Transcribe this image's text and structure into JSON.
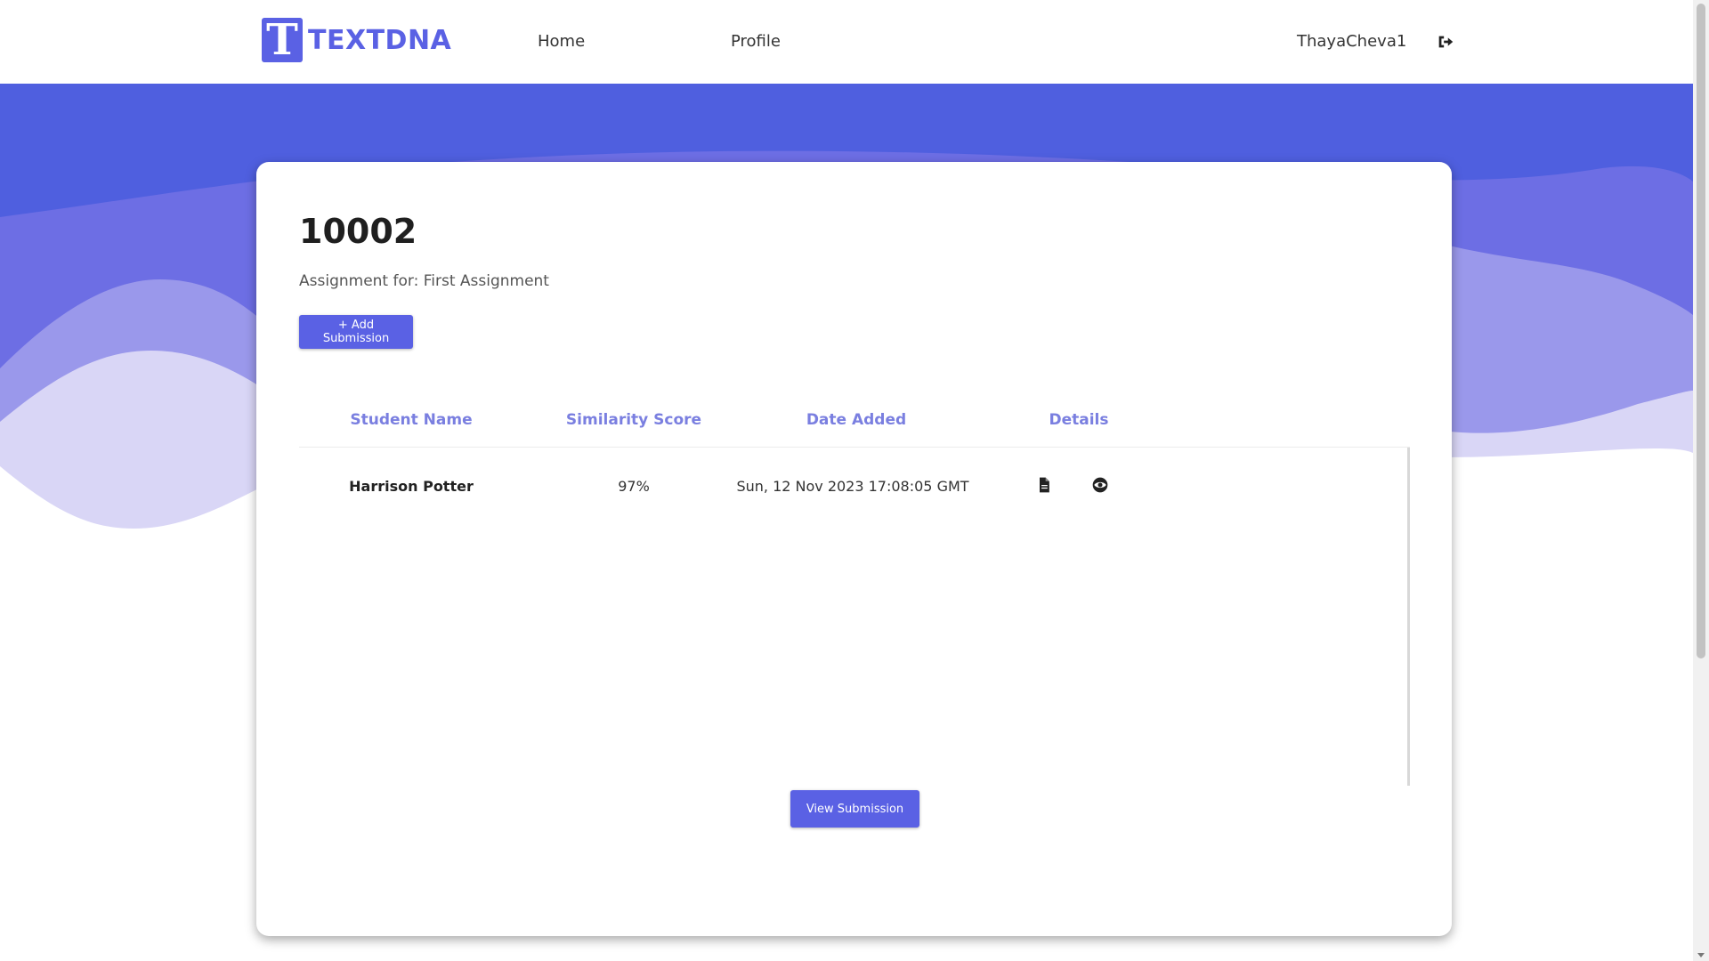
{
  "brand": {
    "logo_letter": "T",
    "name": "TEXTDNA",
    "color": "#5a61e4"
  },
  "nav": {
    "home_label": "Home",
    "profile_label": "Profile",
    "username": "ThayaCheva1"
  },
  "assignment": {
    "id": "10002",
    "subtitle": "Assignment for: First Assignment",
    "add_button_label": "+ Add Submission"
  },
  "table": {
    "headers": [
      "Student Name",
      "Similarity Score",
      "Date Added",
      "Details"
    ],
    "rows": [
      {
        "student_name": "Harrison Potter",
        "similarity_score": "97%",
        "date_added": "Sun, 12 Nov 2023 17:08:05 GMT",
        "detail_icons": [
          "document-icon",
          "eye-icon"
        ]
      }
    ]
  },
  "view_button_label": "View Submission",
  "colors": {
    "accent": "#5a61e4",
    "header_text": "#7a7fe0",
    "band": "#4f5fdf",
    "wave_mid": "#8f8fe9",
    "wave_light": "#d9d6f6"
  }
}
